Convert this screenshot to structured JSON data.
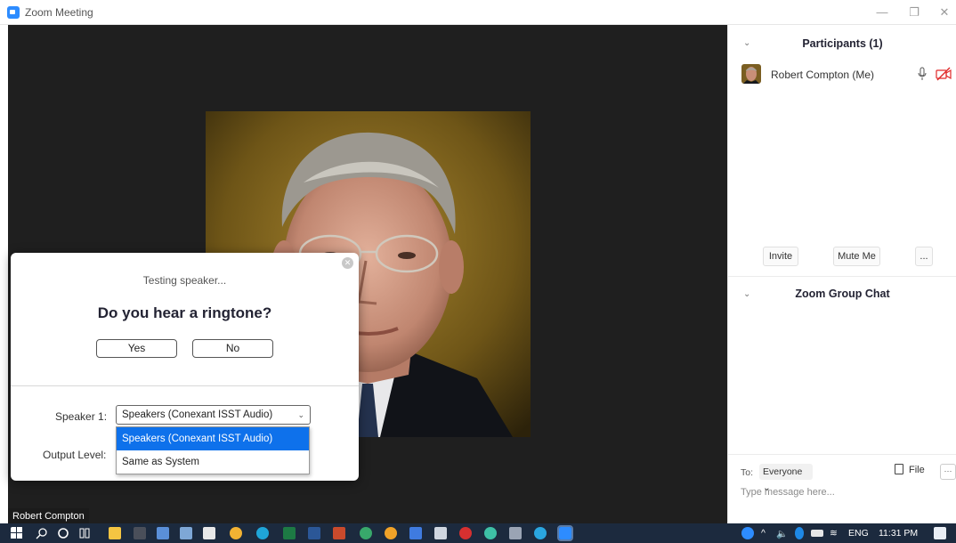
{
  "window": {
    "title": "Zoom Meeting",
    "controls": {
      "minimize": "—",
      "restore": "❐",
      "close": "✕"
    }
  },
  "video": {
    "participant_name_tag": "Robert Compton"
  },
  "speaker_test": {
    "status": "Testing speaker...",
    "question": "Do you hear a ringtone?",
    "yes_label": "Yes",
    "no_label": "No",
    "speaker_label": "Speaker 1:",
    "speaker_selected": "Speakers (Conexant ISST Audio)",
    "output_label": "Output Level:",
    "options": [
      "Speakers (Conexant ISST Audio)",
      "Same as System"
    ],
    "highlighted_option": 0
  },
  "participants_panel": {
    "title": "Participants (1)",
    "participants": [
      {
        "name": "Robert Compton (Me)",
        "mic": "unmuted",
        "video": "off"
      }
    ],
    "buttons": {
      "invite": "Invite",
      "mute_me": "Mute Me",
      "more": "..."
    }
  },
  "chat_panel": {
    "title": "Zoom Group Chat",
    "to_label": "To:",
    "to_value": "Everyone ⌄",
    "file_label": "File",
    "more": "···",
    "placeholder": "Type message here..."
  },
  "taskbar": {
    "language": "ENG",
    "time": "11:31 PM"
  },
  "colors": {
    "accent": "#2d8cff",
    "selection": "#0e71eb",
    "video_bg": "#1f1f1f",
    "taskbar_bg": "#1c2a3e",
    "video_off_red": "#e02828"
  }
}
